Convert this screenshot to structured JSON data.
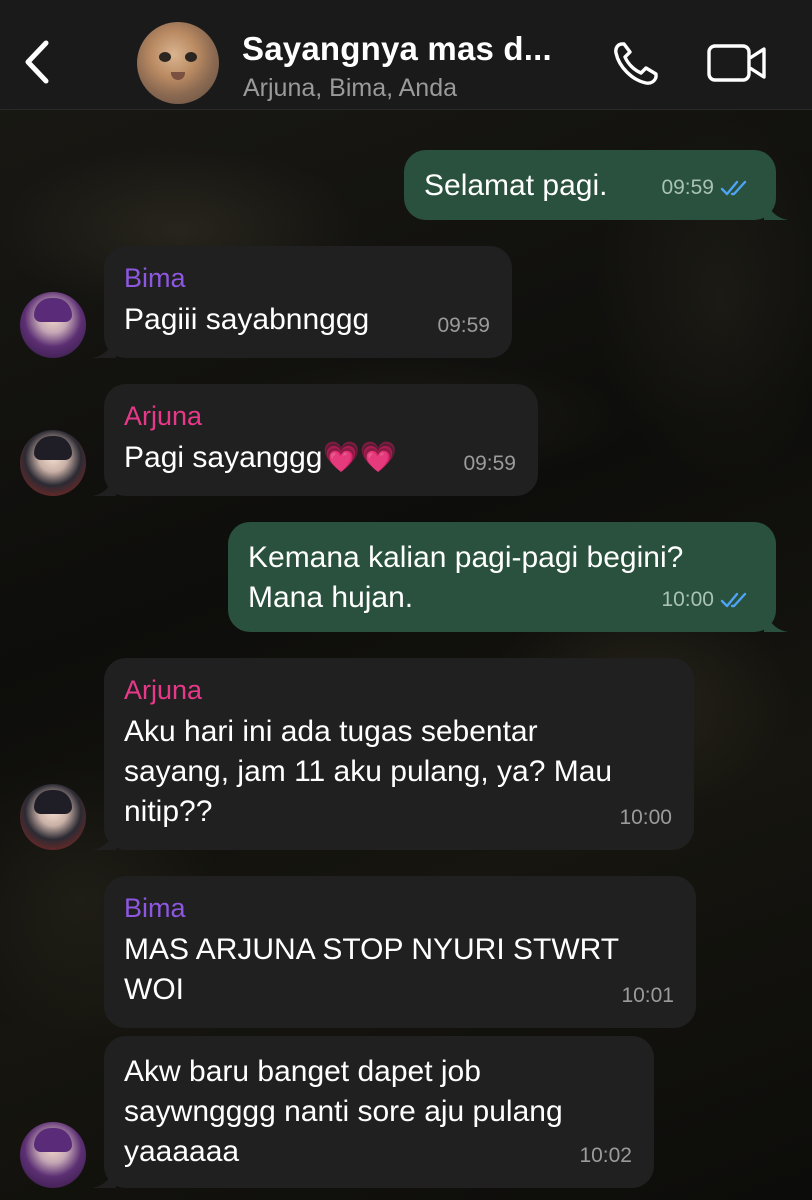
{
  "header": {
    "title": "Sayangnya mas d...",
    "subtitle": "Arjuna, Bima, Anda",
    "back_icon": "chevron-left-icon",
    "call_icon": "phone-icon",
    "video_icon": "video-camera-icon"
  },
  "colors": {
    "outgoing_bubble": "#29513d",
    "incoming_bubble": "#202020",
    "bima_name": "#8d57e0",
    "arjuna_name": "#e8388a",
    "read_ticks": "#4ea3f5"
  },
  "messages": [
    {
      "direction": "out",
      "text": "Selamat pagi.",
      "time": "09:59",
      "status": "read"
    },
    {
      "direction": "in",
      "sender": "Bima",
      "text": "Pagiii sayabnnggg",
      "time": "09:59"
    },
    {
      "direction": "in",
      "sender": "Arjuna",
      "text": "Pagi sayanggg💗💗",
      "time": "09:59"
    },
    {
      "direction": "out",
      "lines": [
        "Kemana kalian pagi-pagi begini?",
        "Mana hujan."
      ],
      "time": "10:00",
      "status": "read"
    },
    {
      "direction": "in",
      "sender": "Arjuna",
      "lines": [
        "Aku hari ini ada tugas sebentar",
        "sayang, jam 11 aku pulang, ya? Mau",
        "nitip??"
      ],
      "time": "10:00"
    },
    {
      "direction": "in",
      "sender": "Bima",
      "lines": [
        "MAS ARJUNA STOP NYURI STWRT",
        "WOI"
      ],
      "time": "10:01"
    },
    {
      "direction": "in",
      "lines": [
        "Akw baru banget dapet job",
        "saywngggg nanti sore aju pulang",
        "yaaaaaa"
      ],
      "time": "10:02"
    }
  ]
}
